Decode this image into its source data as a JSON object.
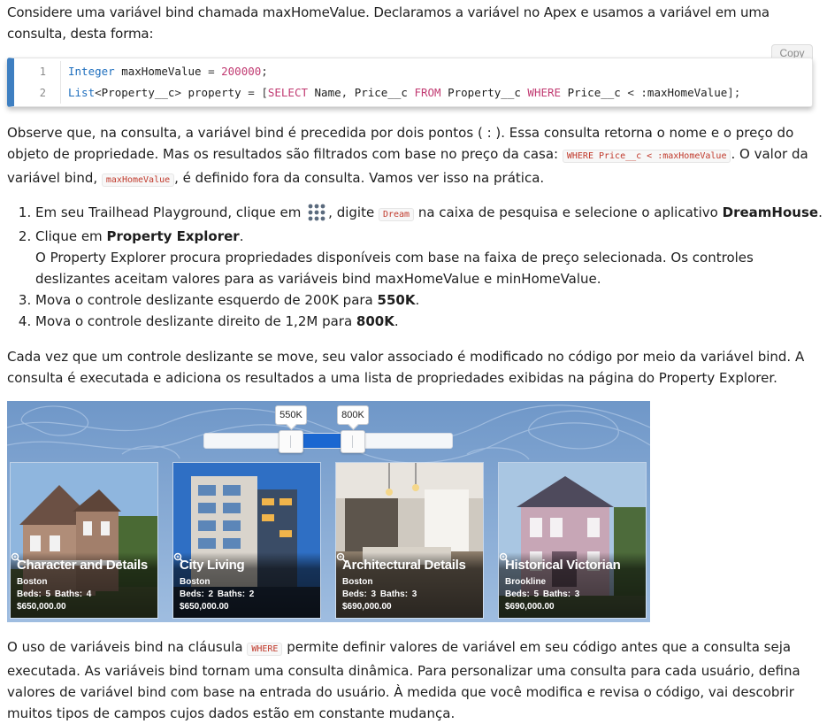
{
  "intro": {
    "line1": "Considere uma variável bind chamada maxHomeValue. Declaramos a variável no Apex e usamos a variável em uma",
    "line2": "consulta, desta forma:"
  },
  "code_block": {
    "copy_label": "Copy",
    "lines": [
      {
        "number": "1",
        "text": "Integer maxHomeValue = 200000;"
      },
      {
        "number": "2",
        "text": "List<Property__c> property = [SELECT Name, Price__c FROM Property__c WHERE Price__c < :maxHomeValue];"
      }
    ]
  },
  "paragraph2": {
    "part1": "Observe que, na consulta, a variável bind é precedida por dois pontos ( : ). Essa consulta retorna o nome e o preço do",
    "part2": "objeto de propriedade. Mas os resultados são filtrados com base no preço da casa: ",
    "code1": "WHERE Price__c < :maxHomeValue",
    "part3": ". O valor da",
    "part4": "variável bind, ",
    "code2": "maxHomeValue",
    "part5": ", é definido fora da consulta. Vamos ver isso na prática."
  },
  "steps": {
    "step1": {
      "a": "Em seu Trailhead Playground, clique em ",
      "icon": "app-launcher-icon",
      "b": ", digite ",
      "code": "Dream",
      "c": " na caixa de pesquisa e selecione o aplicativo ",
      "bold": "DreamHouse",
      "d": "."
    },
    "step2": {
      "a": "Clique em ",
      "bold": "Property Explorer",
      "b": ".",
      "detail1": "O Property Explorer procura propriedades disponíveis com base na faixa de preço selecionada. Os controles",
      "detail2": "deslizantes aceitam valores para as variáveis bind maxHomeValue e minHomeValue."
    },
    "step3": {
      "a": "Mova o controle deslizante esquerdo de 200K para ",
      "bold": "550K",
      "b": "."
    },
    "step4": {
      "a": "Mova o controle deslizante direito de 1,2M para ",
      "bold": "800K",
      "b": "."
    }
  },
  "paragraph3": {
    "line1": "Cada vez que um controle deslizante se move, seu valor associado é modificado no código por meio da variável bind. A",
    "line2": "consulta é executada e adiciona os resultados a uma lista de propriedades exibidas na página do Property Explorer."
  },
  "figure": {
    "slider": {
      "min_label": "550K",
      "max_label": "800K"
    },
    "cards": [
      {
        "title": "Character and Details",
        "city": "Boston",
        "beds": "Beds: 5",
        "baths": "Baths: 4",
        "price": "$650,000.00"
      },
      {
        "title": "City Living",
        "city": "Boston",
        "beds": "Beds: 2",
        "baths": "Baths: 2",
        "price": "$650,000.00"
      },
      {
        "title": "Architectural Details",
        "city": "Boston",
        "beds": "Beds: 3",
        "baths": "Baths: 3",
        "price": "$690,000.00"
      },
      {
        "title": "Historical Victorian",
        "city": "Brookline",
        "beds": "Beds: 5",
        "baths": "Baths: 3",
        "price": "$690,000.00"
      }
    ]
  },
  "paragraph4": {
    "part1": "O uso de variáveis bind na cláusula ",
    "code": "WHERE",
    "part2": " permite definir valores de variável em seu código antes que a consulta seja",
    "line2": "executada. As variáveis bind tornam uma consulta dinâmica. Para personalizar uma consulta para cada usuário, defina",
    "line3": "valores de variável bind com base na entrada do usuário. À medida que você modifica e revisa o código, vai descobrir",
    "line4": "muitos tipos de campos cujos dados estão em constante mudança."
  },
  "colors": {
    "accent": "#3e7fc1",
    "slider_range": "#1b67d1",
    "inline_code": "#c0392b"
  }
}
